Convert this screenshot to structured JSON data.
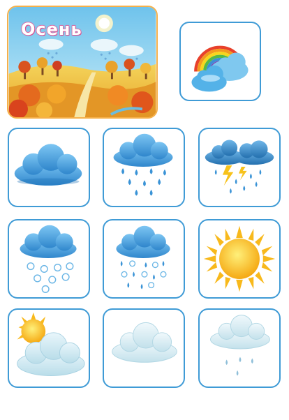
{
  "season": {
    "title": "Осень"
  },
  "colors": {
    "card_border": "#3f9bd6",
    "season_border": "#f6b04a",
    "cloud_blue": "#3a93d6",
    "cloud_light": "#cfe7ef",
    "sun": "#f8b91c"
  },
  "cards": [
    {
      "icon": "rainbow-cloud-icon"
    },
    {
      "icon": "cloud-icon"
    },
    {
      "icon": "rain-icon"
    },
    {
      "icon": "thunderstorm-icon"
    },
    {
      "icon": "snow-icon"
    },
    {
      "icon": "sleet-icon"
    },
    {
      "icon": "sun-icon"
    },
    {
      "icon": "partly-cloudy-icon"
    },
    {
      "icon": "overcast-icon"
    },
    {
      "icon": "light-rain-icon"
    }
  ]
}
